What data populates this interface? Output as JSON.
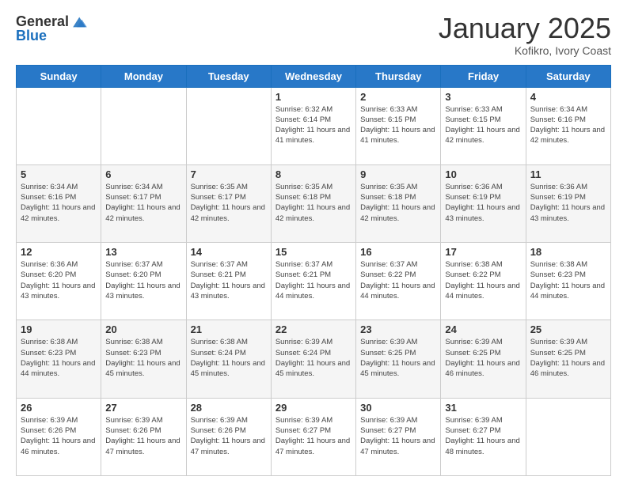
{
  "header": {
    "logo_general": "General",
    "logo_blue": "Blue",
    "month_title": "January 2025",
    "location": "Kofikro, Ivory Coast"
  },
  "days_of_week": [
    "Sunday",
    "Monday",
    "Tuesday",
    "Wednesday",
    "Thursday",
    "Friday",
    "Saturday"
  ],
  "weeks": [
    [
      {
        "day": "",
        "info": ""
      },
      {
        "day": "",
        "info": ""
      },
      {
        "day": "",
        "info": ""
      },
      {
        "day": "1",
        "info": "Sunrise: 6:32 AM\nSunset: 6:14 PM\nDaylight: 11 hours and 41 minutes."
      },
      {
        "day": "2",
        "info": "Sunrise: 6:33 AM\nSunset: 6:15 PM\nDaylight: 11 hours and 41 minutes."
      },
      {
        "day": "3",
        "info": "Sunrise: 6:33 AM\nSunset: 6:15 PM\nDaylight: 11 hours and 42 minutes."
      },
      {
        "day": "4",
        "info": "Sunrise: 6:34 AM\nSunset: 6:16 PM\nDaylight: 11 hours and 42 minutes."
      }
    ],
    [
      {
        "day": "5",
        "info": "Sunrise: 6:34 AM\nSunset: 6:16 PM\nDaylight: 11 hours and 42 minutes."
      },
      {
        "day": "6",
        "info": "Sunrise: 6:34 AM\nSunset: 6:17 PM\nDaylight: 11 hours and 42 minutes."
      },
      {
        "day": "7",
        "info": "Sunrise: 6:35 AM\nSunset: 6:17 PM\nDaylight: 11 hours and 42 minutes."
      },
      {
        "day": "8",
        "info": "Sunrise: 6:35 AM\nSunset: 6:18 PM\nDaylight: 11 hours and 42 minutes."
      },
      {
        "day": "9",
        "info": "Sunrise: 6:35 AM\nSunset: 6:18 PM\nDaylight: 11 hours and 42 minutes."
      },
      {
        "day": "10",
        "info": "Sunrise: 6:36 AM\nSunset: 6:19 PM\nDaylight: 11 hours and 43 minutes."
      },
      {
        "day": "11",
        "info": "Sunrise: 6:36 AM\nSunset: 6:19 PM\nDaylight: 11 hours and 43 minutes."
      }
    ],
    [
      {
        "day": "12",
        "info": "Sunrise: 6:36 AM\nSunset: 6:20 PM\nDaylight: 11 hours and 43 minutes."
      },
      {
        "day": "13",
        "info": "Sunrise: 6:37 AM\nSunset: 6:20 PM\nDaylight: 11 hours and 43 minutes."
      },
      {
        "day": "14",
        "info": "Sunrise: 6:37 AM\nSunset: 6:21 PM\nDaylight: 11 hours and 43 minutes."
      },
      {
        "day": "15",
        "info": "Sunrise: 6:37 AM\nSunset: 6:21 PM\nDaylight: 11 hours and 44 minutes."
      },
      {
        "day": "16",
        "info": "Sunrise: 6:37 AM\nSunset: 6:22 PM\nDaylight: 11 hours and 44 minutes."
      },
      {
        "day": "17",
        "info": "Sunrise: 6:38 AM\nSunset: 6:22 PM\nDaylight: 11 hours and 44 minutes."
      },
      {
        "day": "18",
        "info": "Sunrise: 6:38 AM\nSunset: 6:23 PM\nDaylight: 11 hours and 44 minutes."
      }
    ],
    [
      {
        "day": "19",
        "info": "Sunrise: 6:38 AM\nSunset: 6:23 PM\nDaylight: 11 hours and 44 minutes."
      },
      {
        "day": "20",
        "info": "Sunrise: 6:38 AM\nSunset: 6:23 PM\nDaylight: 11 hours and 45 minutes."
      },
      {
        "day": "21",
        "info": "Sunrise: 6:38 AM\nSunset: 6:24 PM\nDaylight: 11 hours and 45 minutes."
      },
      {
        "day": "22",
        "info": "Sunrise: 6:39 AM\nSunset: 6:24 PM\nDaylight: 11 hours and 45 minutes."
      },
      {
        "day": "23",
        "info": "Sunrise: 6:39 AM\nSunset: 6:25 PM\nDaylight: 11 hours and 45 minutes."
      },
      {
        "day": "24",
        "info": "Sunrise: 6:39 AM\nSunset: 6:25 PM\nDaylight: 11 hours and 46 minutes."
      },
      {
        "day": "25",
        "info": "Sunrise: 6:39 AM\nSunset: 6:25 PM\nDaylight: 11 hours and 46 minutes."
      }
    ],
    [
      {
        "day": "26",
        "info": "Sunrise: 6:39 AM\nSunset: 6:26 PM\nDaylight: 11 hours and 46 minutes."
      },
      {
        "day": "27",
        "info": "Sunrise: 6:39 AM\nSunset: 6:26 PM\nDaylight: 11 hours and 47 minutes."
      },
      {
        "day": "28",
        "info": "Sunrise: 6:39 AM\nSunset: 6:26 PM\nDaylight: 11 hours and 47 minutes."
      },
      {
        "day": "29",
        "info": "Sunrise: 6:39 AM\nSunset: 6:27 PM\nDaylight: 11 hours and 47 minutes."
      },
      {
        "day": "30",
        "info": "Sunrise: 6:39 AM\nSunset: 6:27 PM\nDaylight: 11 hours and 47 minutes."
      },
      {
        "day": "31",
        "info": "Sunrise: 6:39 AM\nSunset: 6:27 PM\nDaylight: 11 hours and 48 minutes."
      },
      {
        "day": "",
        "info": ""
      }
    ]
  ]
}
